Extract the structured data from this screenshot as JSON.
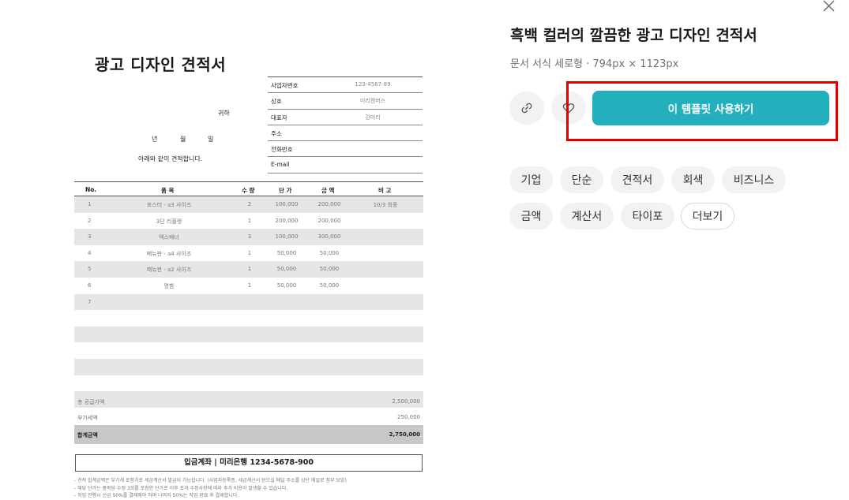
{
  "close": {
    "icon": "close-icon"
  },
  "doc": {
    "title": "광고 디자인 견적서",
    "recipient_suffix": "귀하",
    "date": {
      "year": "년",
      "month": "월",
      "day": "일"
    },
    "intro": "아래와 같이 견적합니다.",
    "info": [
      {
        "label": "사업자번호",
        "value": "123-4567-89"
      },
      {
        "label": "상호",
        "value": "미리캔버스"
      },
      {
        "label": "대표자",
        "value": "강미리"
      },
      {
        "label": "주소",
        "value": ""
      },
      {
        "label": "전화번호",
        "value": ""
      },
      {
        "label": "E-mail",
        "value": ""
      }
    ],
    "columns": [
      "No.",
      "품 목",
      "수 량",
      "단 가",
      "금 액",
      "비 고"
    ],
    "rows": [
      {
        "no": "1",
        "name": "포스터 - a3 사이즈",
        "qty": "2",
        "price": "100,000",
        "amount": "200,000",
        "note": "10/3 최종"
      },
      {
        "no": "2",
        "name": "3단 리플렛",
        "qty": "1",
        "price": "200,000",
        "amount": "200,000",
        "note": ""
      },
      {
        "no": "3",
        "name": "엑스배너",
        "qty": "3",
        "price": "100,000",
        "amount": "300,000",
        "note": ""
      },
      {
        "no": "4",
        "name": "메뉴판 - a4 사이즈",
        "qty": "1",
        "price": "50,000",
        "amount": "50,000",
        "note": ""
      },
      {
        "no": "5",
        "name": "메뉴판 - a2 사이즈",
        "qty": "1",
        "price": "50,000",
        "amount": "50,000",
        "note": ""
      },
      {
        "no": "6",
        "name": "명함",
        "qty": "1",
        "price": "50,000",
        "amount": "50,000",
        "note": ""
      },
      {
        "no": "7",
        "name": "",
        "qty": "",
        "price": "",
        "amount": "",
        "note": ""
      },
      {
        "no": "",
        "name": "",
        "qty": "",
        "price": "",
        "amount": "",
        "note": ""
      },
      {
        "no": "",
        "name": "",
        "qty": "",
        "price": "",
        "amount": "",
        "note": ""
      },
      {
        "no": "",
        "name": "",
        "qty": "",
        "price": "",
        "amount": "",
        "note": ""
      },
      {
        "no": "",
        "name": "",
        "qty": "",
        "price": "",
        "amount": "",
        "note": ""
      },
      {
        "no": "",
        "name": "",
        "qty": "",
        "price": "",
        "amount": "",
        "note": ""
      },
      {
        "no": "",
        "name": "",
        "qty": "",
        "price": "",
        "amount": "",
        "note": ""
      }
    ],
    "supply_label": "총 공급가액",
    "supply_value": "2,500,000",
    "vat_label": "부가세액",
    "vat_value": "250,000",
    "total_label": "합계금액",
    "total_value": "2,750,000",
    "account": "입금계좌 | 미리은행 1234-5678-900",
    "notes": [
      "- 견적 합계금액은 부가세 포함가로 세금계산서 발급이 가능합니다. (사업자등록증, 세금계산서 받으실 메일 주소를 상단 메일로 첨부 요망)",
      "- 해당 단가는 품목당 수정 3회를 포함한 단가로 이후 초과 수정사항에 따라 추가 비용이 발생할 수 있습니다.",
      "- 작업 진행시 선금 50%를 결제해야 하며 나머지 50%는 작업 완료 후 결제합니다."
    ]
  },
  "panel": {
    "title": "흑백 컬러의 깔끔한 광고 디자인 견적서",
    "meta": "문서 서식 세로형 · 794px × 1123px",
    "link_icon": "link-icon",
    "like_icon": "heart-icon",
    "use_button": "이 템플릿 사용하기",
    "tags": [
      "기업",
      "단순",
      "견적서",
      "회색",
      "비즈니스",
      "금액",
      "계산서",
      "타이포"
    ],
    "more": "더보기",
    "accent": "#22b0bd",
    "highlight_color": "#e00000"
  }
}
